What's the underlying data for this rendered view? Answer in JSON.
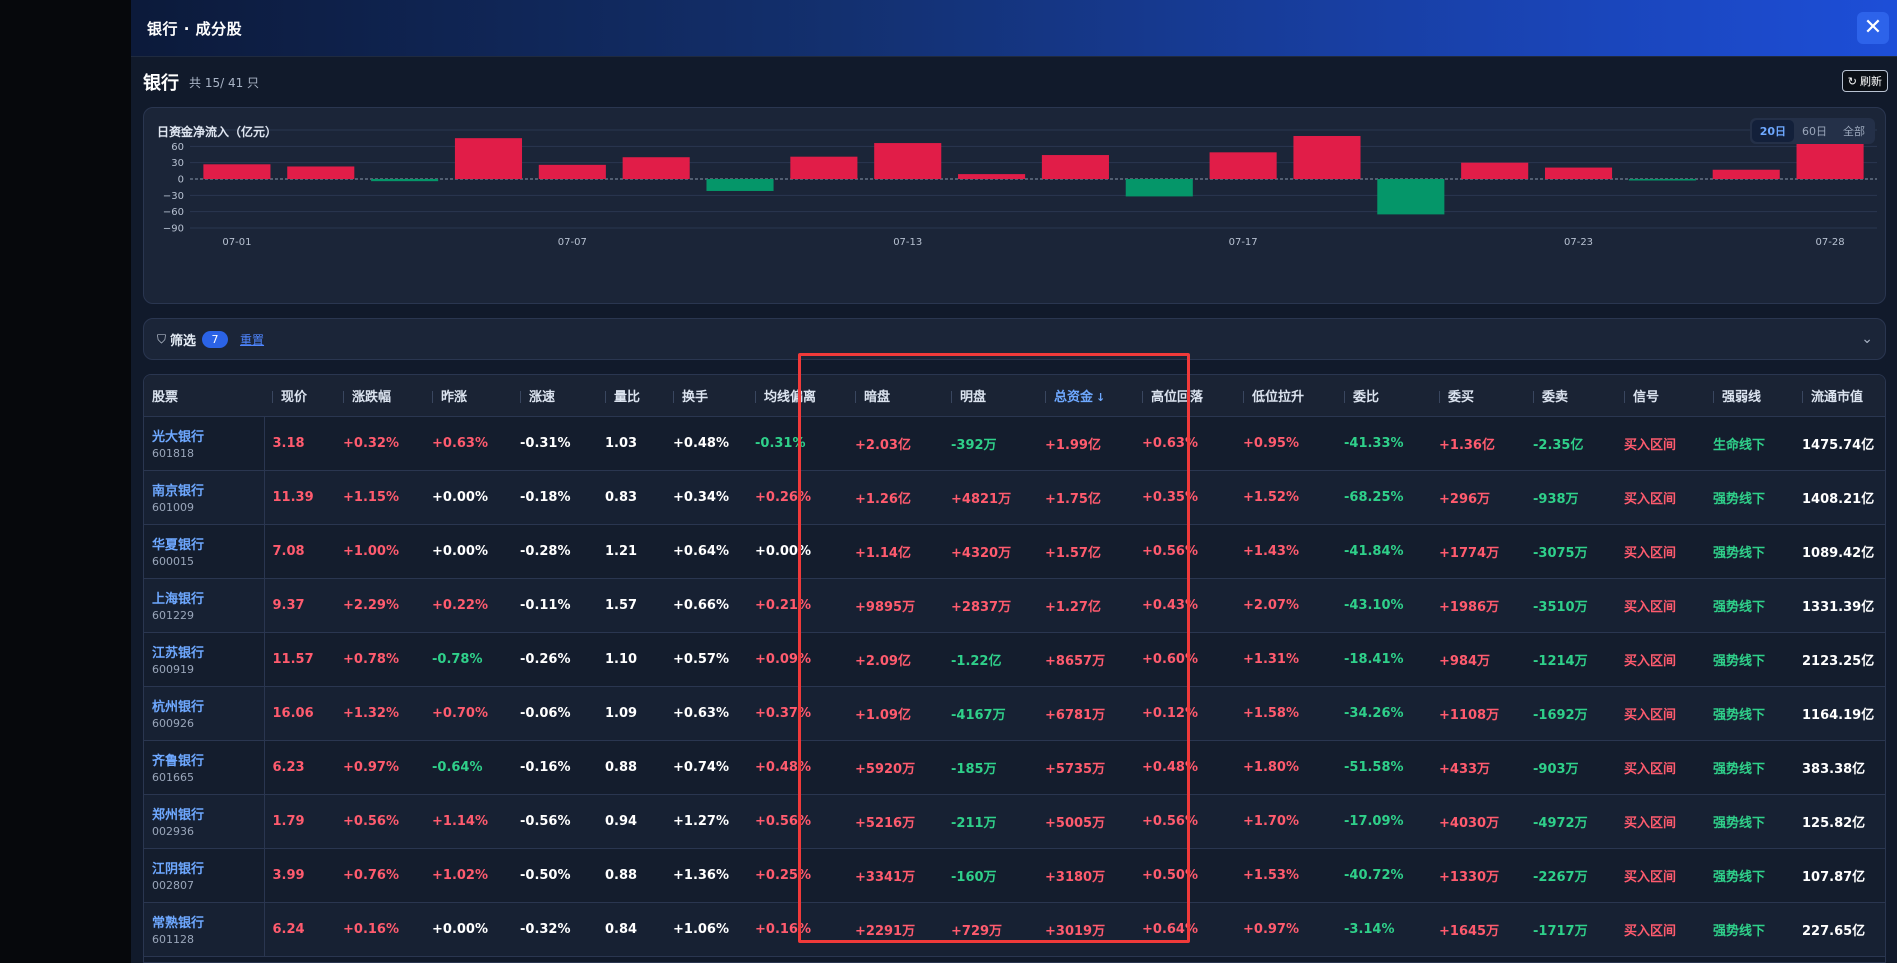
{
  "modal": {
    "title": "银行 · 成分股",
    "close_glyph": "✕"
  },
  "header": {
    "sector": "银行",
    "count_text": "共 15/ 41 只",
    "refresh_label": "刷新",
    "refresh_glyph": "↻"
  },
  "chart_card": {
    "title": "日资金净流入（亿元）",
    "ranges": [
      "20日",
      "60日",
      "全部"
    ],
    "active_range": "20日"
  },
  "chart_data": {
    "type": "bar",
    "categories": [
      "07-01",
      "07-02",
      "07-03",
      "07-07",
      "07-08",
      "07-09",
      "07-10",
      "07-11",
      "07-13",
      "07-14",
      "07-15",
      "07-16",
      "07-17",
      "07-18",
      "07-21",
      "07-22",
      "07-23",
      "07-24",
      "07-25",
      "07-28"
    ],
    "x_tick_labels": [
      "07-01",
      "07-07",
      "07-13",
      "07-17",
      "07-23",
      "07-28"
    ],
    "x_tick_indices": [
      0,
      4,
      8,
      12,
      16,
      19
    ],
    "values": [
      27,
      23,
      -4,
      75,
      26,
      40,
      -22,
      41,
      66,
      9,
      44,
      -32,
      49,
      79,
      -65,
      30,
      21,
      -2,
      17,
      88
    ],
    "ylim": [
      -90,
      90
    ],
    "yticks": [
      90,
      60,
      30,
      0,
      -30,
      -60,
      -90
    ],
    "ytick_labels": [
      "90",
      "60",
      "30",
      "0",
      "−30",
      "−60",
      "−90"
    ],
    "grid": true,
    "colors": {
      "positive": "#e11d48",
      "negative": "#059669",
      "grid": "#2a3650",
      "zero": "#8a96aa"
    }
  },
  "filter": {
    "label": "筛选",
    "count": "7",
    "reset": "重置",
    "funnel_glyph": "⛉",
    "chevron_glyph": "⌄"
  },
  "table": {
    "columns": [
      "股票",
      "现价",
      "涨跌幅",
      "昨涨",
      "涨速",
      "量比",
      "换手",
      "均线偏离",
      "暗盘",
      "明盘",
      "总资金",
      "高位回落",
      "低位拉升",
      "委比",
      "委买",
      "委卖",
      "信号",
      "强弱线",
      "流通市值"
    ],
    "sorted_column": "总资金",
    "sort_glyph": "↓",
    "rows": [
      {
        "name": "光大银行",
        "code": "601818",
        "cells": [
          "3.18",
          "+0.32%",
          "+0.63%",
          "-0.31%",
          "1.03",
          "+0.48%",
          "-0.31%",
          "+2.03亿",
          "-392万",
          "+1.99亿",
          "+0.63%",
          "+0.95%",
          "-41.33%",
          "+1.36亿",
          "-2.35亿",
          "买入区间",
          "生命线下",
          "1475.74亿"
        ]
      },
      {
        "name": "南京银行",
        "code": "601009",
        "cells": [
          "11.39",
          "+1.15%",
          "+0.00%",
          "-0.18%",
          "0.83",
          "+0.34%",
          "+0.26%",
          "+1.26亿",
          "+4821万",
          "+1.75亿",
          "+0.35%",
          "+1.52%",
          "-68.25%",
          "+296万",
          "-938万",
          "买入区间",
          "强势线下",
          "1408.21亿"
        ]
      },
      {
        "name": "华夏银行",
        "code": "600015",
        "cells": [
          "7.08",
          "+1.00%",
          "+0.00%",
          "-0.28%",
          "1.21",
          "+0.64%",
          "+0.00%",
          "+1.14亿",
          "+4320万",
          "+1.57亿",
          "+0.56%",
          "+1.43%",
          "-41.84%",
          "+1774万",
          "-3075万",
          "买入区间",
          "强势线下",
          "1089.42亿"
        ]
      },
      {
        "name": "上海银行",
        "code": "601229",
        "cells": [
          "9.37",
          "+2.29%",
          "+0.22%",
          "-0.11%",
          "1.57",
          "+0.66%",
          "+0.21%",
          "+9895万",
          "+2837万",
          "+1.27亿",
          "+0.43%",
          "+2.07%",
          "-43.10%",
          "+1986万",
          "-3510万",
          "买入区间",
          "强势线下",
          "1331.39亿"
        ]
      },
      {
        "name": "江苏银行",
        "code": "600919",
        "cells": [
          "11.57",
          "+0.78%",
          "-0.78%",
          "-0.26%",
          "1.10",
          "+0.57%",
          "+0.09%",
          "+2.09亿",
          "-1.22亿",
          "+8657万",
          "+0.60%",
          "+1.31%",
          "-18.41%",
          "+984万",
          "-1214万",
          "买入区间",
          "强势线下",
          "2123.25亿"
        ]
      },
      {
        "name": "杭州银行",
        "code": "600926",
        "cells": [
          "16.06",
          "+1.32%",
          "+0.70%",
          "-0.06%",
          "1.09",
          "+0.63%",
          "+0.37%",
          "+1.09亿",
          "-4167万",
          "+6781万",
          "+0.12%",
          "+1.58%",
          "-34.26%",
          "+1108万",
          "-1692万",
          "买入区间",
          "强势线下",
          "1164.19亿"
        ]
      },
      {
        "name": "齐鲁银行",
        "code": "601665",
        "cells": [
          "6.23",
          "+0.97%",
          "-0.64%",
          "-0.16%",
          "0.88",
          "+0.74%",
          "+0.48%",
          "+5920万",
          "-185万",
          "+5735万",
          "+0.48%",
          "+1.80%",
          "-51.58%",
          "+433万",
          "-903万",
          "买入区间",
          "强势线下",
          "383.38亿"
        ]
      },
      {
        "name": "郑州银行",
        "code": "002936",
        "cells": [
          "1.79",
          "+0.56%",
          "+1.14%",
          "-0.56%",
          "0.94",
          "+1.27%",
          "+0.56%",
          "+5216万",
          "-211万",
          "+5005万",
          "+0.56%",
          "+1.70%",
          "-17.09%",
          "+4030万",
          "-4972万",
          "买入区间",
          "强势线下",
          "125.82亿"
        ]
      },
      {
        "name": "江阴银行",
        "code": "002807",
        "cells": [
          "3.99",
          "+0.76%",
          "+1.02%",
          "-0.50%",
          "0.88",
          "+1.36%",
          "+0.25%",
          "+3341万",
          "-160万",
          "+3180万",
          "+0.50%",
          "+1.53%",
          "-40.72%",
          "+1330万",
          "-2267万",
          "买入区间",
          "强势线下",
          "107.87亿"
        ]
      },
      {
        "name": "常熟银行",
        "code": "601128",
        "cells": [
          "6.24",
          "+0.16%",
          "+0.00%",
          "-0.32%",
          "0.84",
          "+1.06%",
          "+0.16%",
          "+2291万",
          "+729万",
          "+3019万",
          "+0.64%",
          "+0.97%",
          "-3.14%",
          "+1645万",
          "-1717万",
          "买入区间",
          "强势线下",
          "227.65亿"
        ]
      }
    ]
  },
  "colors": {
    "accent": "#2d63ea",
    "up": "#ff5b6e",
    "down": "#2fd08a",
    "link": "#6ea8ff",
    "highlight": "#f03a3a"
  }
}
